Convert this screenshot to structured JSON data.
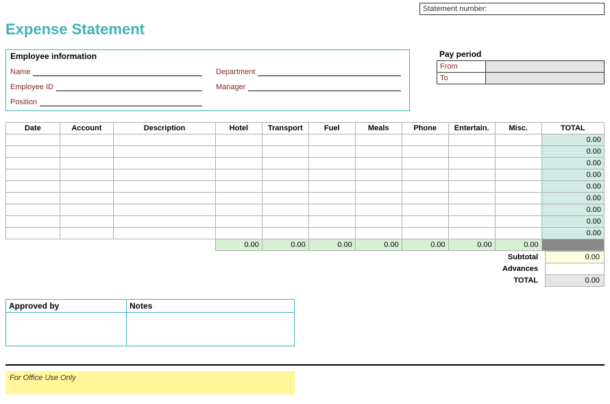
{
  "topbar": {
    "statement_number_label": "Statement number:",
    "statement_number_value": ""
  },
  "title": "Expense Statement",
  "employee": {
    "section_title": "Employee information",
    "name_label": "Name",
    "name_value": "",
    "department_label": "Department",
    "department_value": "",
    "employee_id_label": "Employee ID",
    "employee_id_value": "",
    "manager_label": "Manager",
    "manager_value": "",
    "position_label": "Position",
    "position_value": ""
  },
  "pay_period": {
    "section_title": "Pay period",
    "from_label": "From",
    "from_value": "",
    "to_label": "To",
    "to_value": ""
  },
  "grid": {
    "headers": {
      "date": "Date",
      "account": "Account",
      "description": "Description",
      "hotel": "Hotel",
      "transport": "Transport",
      "fuel": "Fuel",
      "meals": "Meals",
      "phone": "Phone",
      "entertain": "Entertain.",
      "misc": "Misc.",
      "total": "TOTAL"
    },
    "rows": [
      {
        "total": "0.00"
      },
      {
        "total": "0.00"
      },
      {
        "total": "0.00"
      },
      {
        "total": "0.00"
      },
      {
        "total": "0.00"
      },
      {
        "total": "0.00"
      },
      {
        "total": "0.00"
      },
      {
        "total": "0.00"
      },
      {
        "total": "0.00"
      }
    ],
    "sum": {
      "hotel": "0.00",
      "transport": "0.00",
      "fuel": "0.00",
      "meals": "0.00",
      "phone": "0.00",
      "entertain": "0.00",
      "misc": "0.00"
    }
  },
  "summary": {
    "subtotal_label": "Subtotal",
    "subtotal_value": "0.00",
    "advances_label": "Advances",
    "advances_value": "",
    "total_label": "TOTAL",
    "total_value": "0.00"
  },
  "approval": {
    "approved_by_label": "Approved by",
    "approved_by_value": "",
    "notes_label": "Notes",
    "notes_value": ""
  },
  "footer": {
    "office_use_only": "For Office Use Only"
  }
}
